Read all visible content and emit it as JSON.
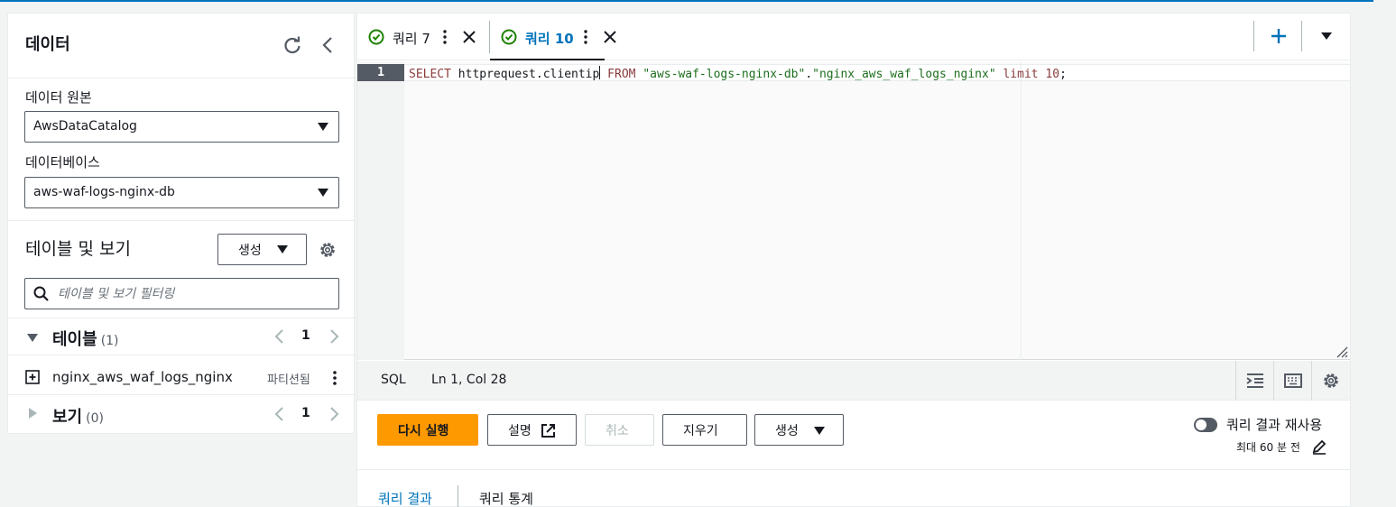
{
  "left_panel": {
    "title": "데이터",
    "data_source_label": "데이터 원본",
    "data_source_value": "AwsDataCatalog",
    "database_label": "데이터베이스",
    "database_value": "aws-waf-logs-nginx-db",
    "tables_views_title": "테이블 및 보기",
    "create_label": "생성",
    "filter_placeholder": "테이블 및 보기 필터링",
    "tables_section": {
      "label": "테이블",
      "count": "(1)",
      "page": "1"
    },
    "table_items": [
      {
        "name": "nginx_aws_waf_logs_nginx",
        "badge": "파티션됨"
      }
    ],
    "views_section": {
      "label": "보기",
      "count": "(0)",
      "page": "1"
    }
  },
  "tabs": [
    {
      "label": "쿼리 7",
      "active": false
    },
    {
      "label": "쿼리 10",
      "active": true
    }
  ],
  "editor": {
    "line_number": "1",
    "tokens": {
      "kw_select": "SELECT",
      "col": " httprequest.clientip",
      "kw_from": " FROM ",
      "db": "\"aws-waf-logs-nginx-db\"",
      "dot": ".",
      "table": "\"nginx_aws_waf_logs_nginx\"",
      "kw_limit": " limit ",
      "limit_val": "10",
      "semi": ";"
    }
  },
  "status_bar": {
    "language": "SQL",
    "position": "Ln 1, Col 28"
  },
  "actions": {
    "run_again": "다시 실행",
    "explain": "설명",
    "cancel": "취소",
    "clear": "지우기",
    "create": "생성",
    "reuse_label": "쿼리 결과 재사용",
    "reuse_sub": "최대 60 분 전"
  },
  "result_tabs": [
    "쿼리 결과",
    "쿼리 통계"
  ],
  "colors": {
    "accent": "#0073bb",
    "primary_button": "#ff9900",
    "success": "#1d8102"
  }
}
